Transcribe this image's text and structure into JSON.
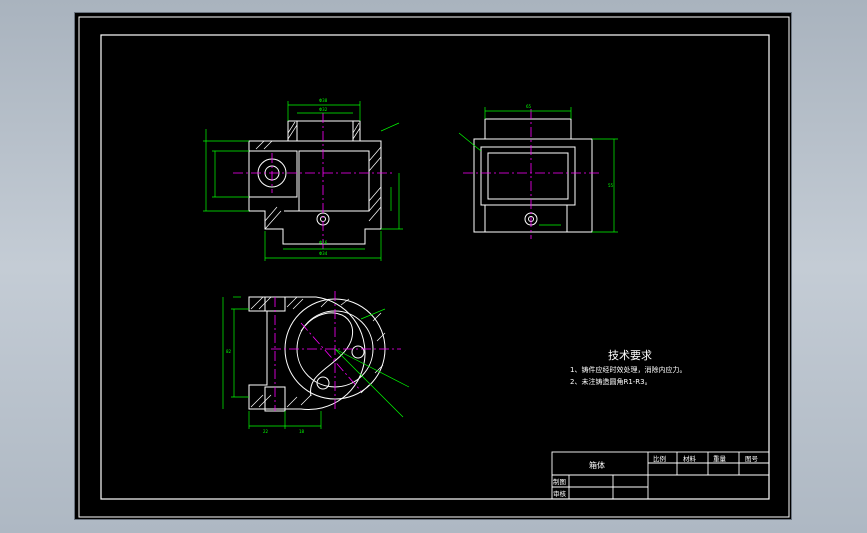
{
  "drawing": {
    "tech_requirements": {
      "heading": "技术要求",
      "items": [
        "1、铸件应经时效处理，消除内应力。",
        "2、未注铸造圆角R1-R3。"
      ]
    },
    "title_block": {
      "part_name": "箱体",
      "headers": [
        "比例",
        "材料",
        "重量",
        "图号"
      ],
      "drawn_label": "制图",
      "checked_label": "审核"
    }
  }
}
